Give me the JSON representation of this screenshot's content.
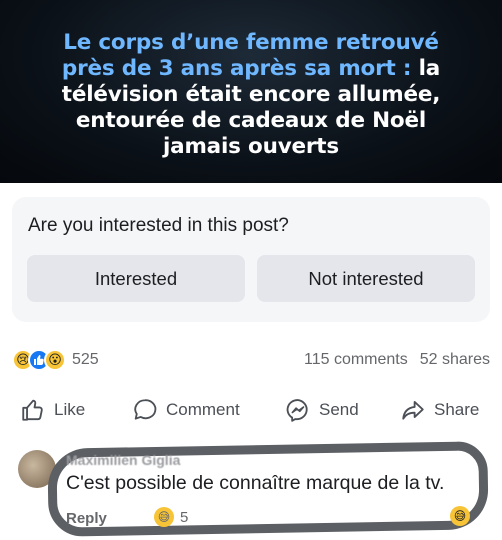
{
  "hero": {
    "title_part1": "Le corps d’une femme retrouvé",
    "title_part2": "près de 3 ans après sa mort :",
    "title_part3": "la",
    "title_part4": "télévision était encore allumée,",
    "title_part5": "entourée de cadeaux de Noël",
    "title_part6": "jamais ouverts"
  },
  "survey": {
    "question": "Are you interested in this post?",
    "interested_label": "Interested",
    "not_interested_label": "Not interested"
  },
  "stats": {
    "reaction_icons": [
      "sad-emoji",
      "like-thumb",
      "wow-emoji"
    ],
    "reaction_count": "525",
    "comments": "115 comments",
    "shares": "52 shares"
  },
  "actions": {
    "like": "Like",
    "comment": "Comment",
    "send": "Send",
    "share": "Share"
  },
  "comment": {
    "author": "Maximilien Giglia",
    "text": "C'est possible de connaître marque de la tv.",
    "reply_label": "Reply",
    "reaction_count": "5"
  },
  "colors": {
    "hero_highlight": "#6fb7ff",
    "like_blue": "#1877f2",
    "button_grey": "#e4e6eb",
    "annotation_ink": "#5c5f63"
  }
}
